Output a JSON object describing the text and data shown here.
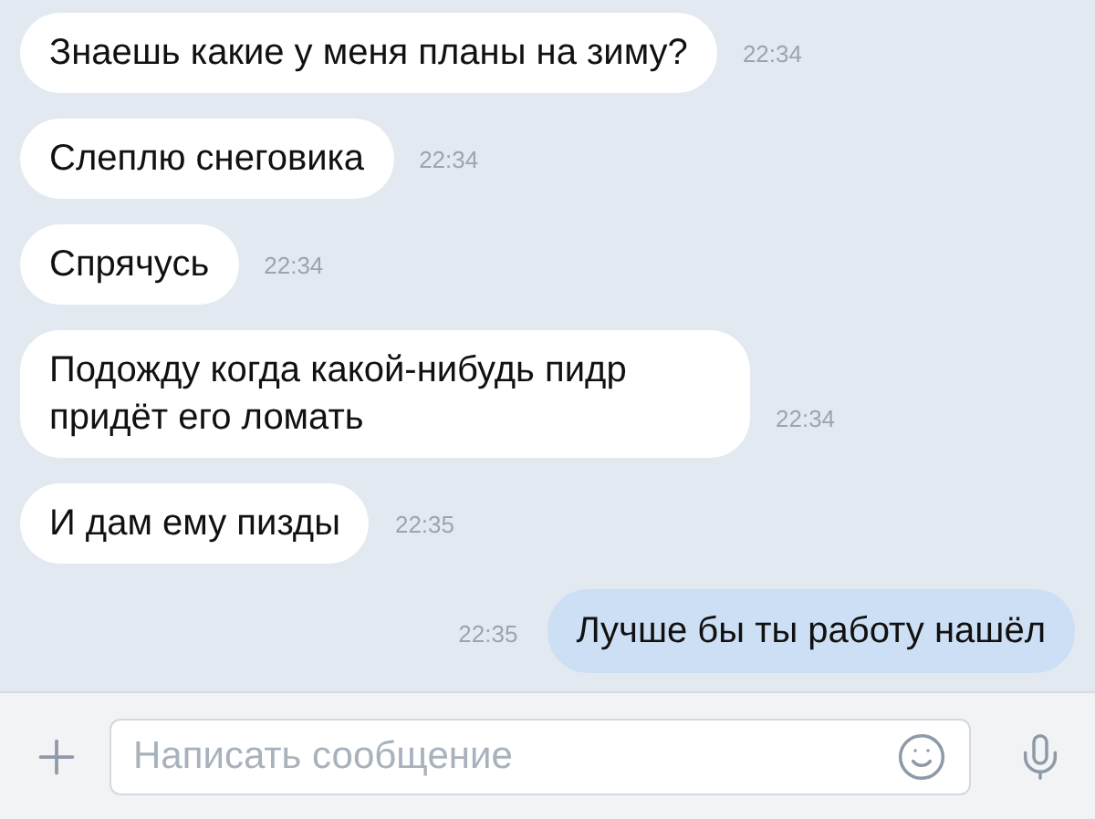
{
  "messages": [
    {
      "text": "Знаешь какие у меня планы на зиму?",
      "time": "22:34",
      "outgoing": false
    },
    {
      "text": "Слеплю снеговика",
      "time": "22:34",
      "outgoing": false
    },
    {
      "text": "Спрячусь",
      "time": "22:34",
      "outgoing": false
    },
    {
      "text": "Подожду когда какой-нибудь пидр придёт его ломать",
      "time": "22:34",
      "outgoing": false
    },
    {
      "text": "И дам ему пизды",
      "time": "22:35",
      "outgoing": false
    },
    {
      "text": "Лучше бы ты работу нашёл",
      "time": "22:35",
      "outgoing": true
    }
  ],
  "composer": {
    "placeholder": "Написать сообщение"
  }
}
